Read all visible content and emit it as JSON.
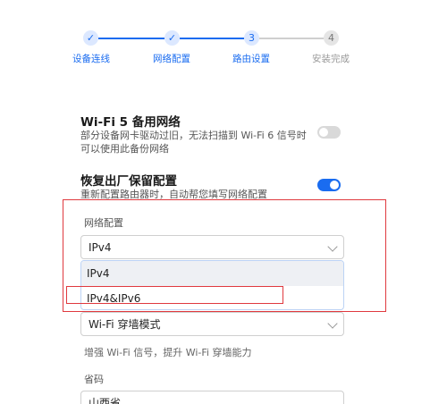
{
  "stepper": {
    "steps": [
      {
        "label": "设备连线",
        "marker": "✓",
        "state": "done"
      },
      {
        "label": "网络配置",
        "marker": "✓",
        "state": "done"
      },
      {
        "label": "路由设置",
        "marker": "3",
        "state": "active"
      },
      {
        "label": "安装完成",
        "marker": "4",
        "state": "pending"
      }
    ]
  },
  "wifi5_backup": {
    "title": "Wi-Fi 5 备用网络",
    "description": "部分设备网卡驱动过旧，无法扫描到 Wi-Fi 6 信号时可以使用此备份网络",
    "enabled": false
  },
  "restore_config": {
    "title": "恢复出厂保留配置",
    "description": "重新配置路由器时，自动帮您填写网络配置",
    "enabled": true
  },
  "network_config": {
    "label": "网络配置",
    "selected": "IPv4",
    "options": [
      "IPv4",
      "IPv4&IPv6"
    ]
  },
  "wifi_mode": {
    "selected": "Wi-Fi 穿墙模式",
    "hint": "增强 Wi-Fi 信号，提升 Wi-Fi 穿墙能力"
  },
  "province": {
    "label": "省码",
    "value": "山西省"
  },
  "colors": {
    "accent": "#1a6cf0",
    "annotation_red": "#e0393e"
  }
}
